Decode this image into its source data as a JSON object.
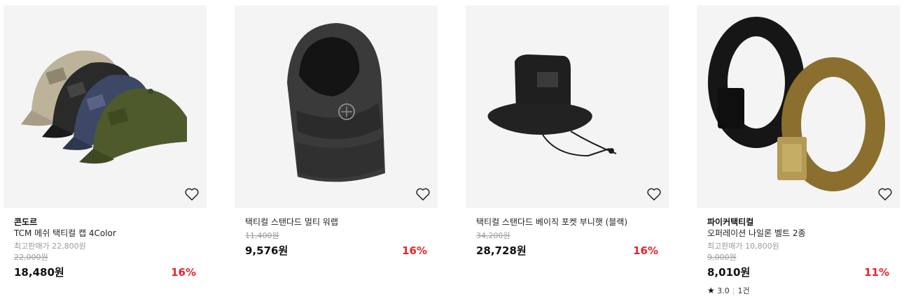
{
  "products": [
    {
      "brand": "콘도르",
      "name": "TCM 메쉬 택티컬 캡 4Color",
      "best_price": "최고판매가 22,800원",
      "original_price": "22,000원",
      "price": "18,480원",
      "discount": "16%",
      "image_icon": "tactical-cap-image"
    },
    {
      "brand": "",
      "name": "택티컬 스탠다드 멀티 워랩",
      "original_price": "11,400원",
      "price": "9,576원",
      "discount": "16%",
      "image_icon": "multi-wrap-image"
    },
    {
      "brand": "",
      "name": "택티컬 스탠다드 베이직 포켓 부니햇 (블랙)",
      "original_price": "34,200원",
      "price": "28,728원",
      "discount": "16%",
      "image_icon": "boonie-hat-image"
    },
    {
      "brand": "파이커택티컬",
      "name": "오퍼레이션 나일론 벨트 2종",
      "best_price": "최고판매가 10,800원",
      "original_price": "9,000원",
      "price": "8,010원",
      "discount": "11%",
      "rating": "3.0",
      "review_count": "1건",
      "image_icon": "nylon-belt-image"
    }
  ],
  "colors": {
    "discount": "#e8232c",
    "thumb_bg": "#f4f4f4",
    "muted": "#9a9a9a"
  },
  "icons": {
    "wishlist": "heart-icon",
    "rating": "star-icon"
  }
}
